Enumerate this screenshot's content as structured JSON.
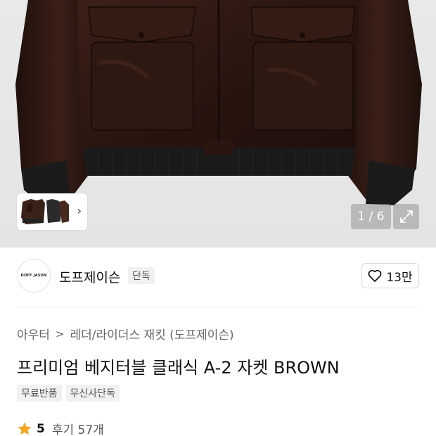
{
  "gallery": {
    "counter": "1 / 6",
    "thumbnail_chevron": "chevron-right-icon",
    "expand_icon": "expand-icon"
  },
  "brand": {
    "logo_text": "DOFF JASON",
    "name": "도프제이슨",
    "badge": "단독",
    "likes": "13만"
  },
  "product": {
    "breadcrumb": [
      "아우터",
      "레더/라이더스 재킷 (도프제이슨)"
    ],
    "title": "프리미엄 베지터블 클래식 A-2 자켓 BROWN",
    "tags": [
      "무료반품",
      "무신사단독"
    ],
    "rating": "5",
    "reviews": "후기 57개"
  },
  "colors": {
    "star": "#f5a623",
    "jacket": "#2f1a14",
    "rib": "#1c1c1c"
  }
}
